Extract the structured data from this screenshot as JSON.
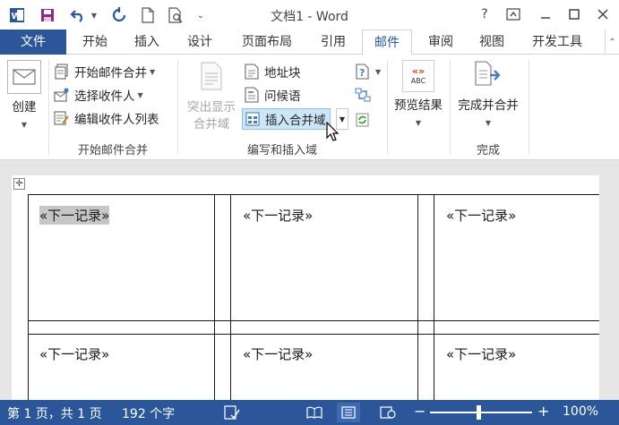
{
  "titlebar": {
    "title": "文档1 - Word",
    "help": "?"
  },
  "tabs": [
    "文件",
    "开始",
    "插入",
    "设计",
    "页面布局",
    "引用",
    "邮件",
    "审阅",
    "视图",
    "开发工具"
  ],
  "active_tab": "邮件",
  "ribbon": {
    "create": "创建",
    "start_merge": "开始邮件合并",
    "select_recipients": "选择收件人",
    "edit_recipients": "编辑收件人列表",
    "group_start": "开始邮件合并",
    "highlight_line1": "突出显示",
    "highlight_line2": "合并域",
    "address_block": "地址块",
    "greeting_line": "问候语",
    "insert_merge_field": "插入合并域",
    "group_write": "编写和插入域",
    "preview_results": "预览结果",
    "preview_badge": "ABC",
    "finish_merge": "完成并合并",
    "group_finish": "完成"
  },
  "document": {
    "cells": [
      "«下一记录»",
      "«下一记录»",
      "«下一记录»",
      "«下一记录»",
      "«下一记录»",
      "«下一记录»"
    ]
  },
  "statusbar": {
    "page": "第 1 页，共 1 页",
    "words": "192 个字",
    "zoom": "100%"
  },
  "colors": {
    "brand": "#2b579a",
    "hover": "#cde6f7",
    "selection": "#c6c6c6"
  }
}
